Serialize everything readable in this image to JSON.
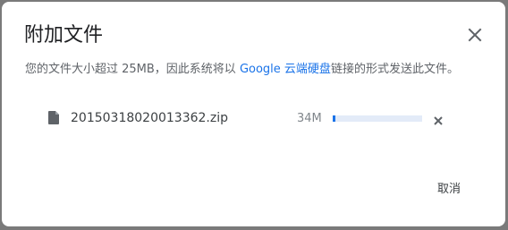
{
  "dialog": {
    "title": "附加文件",
    "message": {
      "prefix": "您的文件大小超过 25MB，因此系统将以 ",
      "link": "Google 云端硬盘",
      "suffix": "链接的形式发送此文件。"
    },
    "file": {
      "name": "20150318020013362.zip",
      "size": "34M",
      "upload_progress": 0.03
    },
    "cancel_label": "取消"
  },
  "icons": {
    "close": "close-icon",
    "file": "file-icon",
    "remove": "remove-file-icon"
  },
  "colors": {
    "link": "#1a73e8",
    "progress_fill": "#1a73e8",
    "progress_track": "#e3ebf8"
  }
}
